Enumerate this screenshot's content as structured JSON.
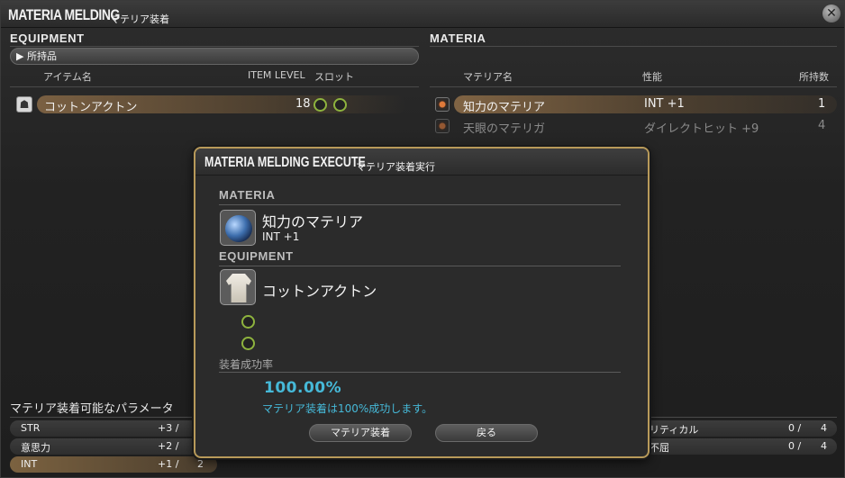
{
  "window": {
    "title": "MATERIA MELDING",
    "subtitle": "マテリア装着"
  },
  "equipment": {
    "header": "EQUIPMENT",
    "filter": "所持品",
    "col_name": "アイテム名",
    "col_level": "ITEM LEVEL",
    "col_slot": "スロット",
    "items": [
      {
        "name": "コットンアクトン",
        "level": "18",
        "slots": 2
      }
    ]
  },
  "materia": {
    "header": "MATERIA",
    "col_name": "マテリア名",
    "col_effect": "性能",
    "col_count": "所持数",
    "items": [
      {
        "name": "知力のマテリア",
        "effect": "INT +1",
        "count": "1",
        "selected": true
      },
      {
        "name": "天眼のマテリガ",
        "effect": "ダイレクトヒット +9",
        "count": "4",
        "selected": false
      }
    ]
  },
  "params": {
    "title": "マテリア装着可能なパラメータ",
    "left": [
      {
        "name": "STR",
        "value": "+3 /"
      },
      {
        "name": "意思力",
        "value": "+2 /"
      },
      {
        "name": "INT",
        "value": "+1 /",
        "max": "2",
        "highlight": true
      }
    ],
    "right": [
      {
        "name": "リティカル",
        "value": "0 /",
        "max": "4"
      },
      {
        "name": "不屈",
        "value": "0 /",
        "max": "4"
      }
    ]
  },
  "dialog": {
    "title": "MATERIA MELDING EXECUTE",
    "subtitle": "マテリア装着実行",
    "materia_header": "MATERIA",
    "materia_name": "知力のマテリア",
    "materia_effect": "INT +1",
    "equipment_header": "EQUIPMENT",
    "equipment_name": "コットンアクトン",
    "rate_label": "装着成功率",
    "rate_value": "100.00%",
    "rate_note": "マテリア装着は100%成功します。",
    "confirm_label": "マテリア装着",
    "back_label": "戻る"
  },
  "colors": {
    "accent_blue": "#46b9d8",
    "slot_green": "#8eb33e",
    "highlight_row": "#96734b",
    "dialog_border": "#b89a5a"
  },
  "icons": {
    "close": "close-icon",
    "equipment": "equipment-icon",
    "materia": "materia-icon"
  }
}
